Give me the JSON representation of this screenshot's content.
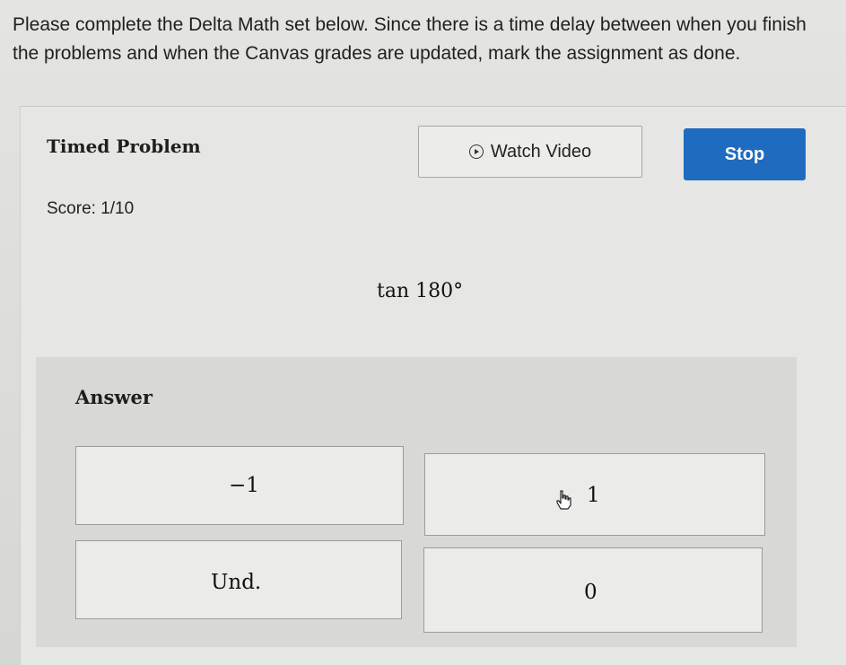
{
  "instructions": {
    "line1": "Please complete the Delta Math set below. Since there is a time delay between when you finish",
    "line2": "the problems and when the Canvas grades are updated, mark the assignment as done."
  },
  "header": {
    "title": "Timed Problem",
    "watch_video_label": "Watch Video",
    "stop_label": "Stop"
  },
  "score": {
    "text": "Score: 1/10"
  },
  "problem": {
    "expression": "tan 180°"
  },
  "answer": {
    "label": "Answer",
    "choices": [
      "−1",
      "1",
      "Und.",
      "0"
    ]
  },
  "colors": {
    "stop_button": "#1f6bbf",
    "background": "#e2e2e0"
  },
  "icons": {
    "watch_video": "play-circle-icon",
    "cursor": "hand-pointer-icon"
  }
}
